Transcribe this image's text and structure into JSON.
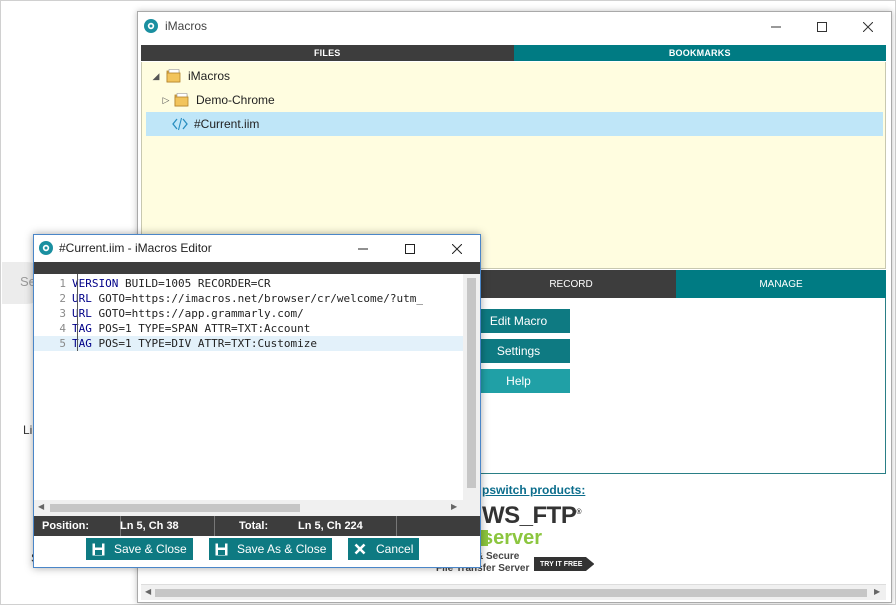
{
  "background": {
    "pill_text": "Se",
    "fragment_1": "Li",
    "fragment_2": "S"
  },
  "main_window": {
    "title": "iMacros",
    "tabs": {
      "files": "FILES",
      "bookmarks": "BOOKMARKS"
    },
    "tree": [
      {
        "label": "iMacros",
        "type": "folder",
        "expanded": true
      },
      {
        "label": "Demo-Chrome",
        "type": "folder",
        "expanded": false
      },
      {
        "label": "#Current.iim",
        "type": "macro",
        "selected": true
      }
    ],
    "sub_tabs": {
      "record": "RECORD",
      "manage": "MANAGE"
    },
    "buttons": {
      "edit_macro": "Edit Macro",
      "settings": "Settings",
      "help": "Help"
    },
    "ad": {
      "heading": "pswitch products:",
      "logo_main": "WS_FTP",
      "logo_reg": "®",
      "logo_sub": "server",
      "tagline_1": "& Secure",
      "tagline_2": "File Transfer Server",
      "try_free": "TRY IT FREE"
    }
  },
  "editor": {
    "title": "#Current.iim - iMacros Editor",
    "lines": [
      {
        "num": "1",
        "keyword": "VERSION",
        "rest": " BUILD=1005 RECORDER=CR"
      },
      {
        "num": "2",
        "keyword": "URL",
        "rest": " GOTO=https://imacros.net/browser/cr/welcome/?utm_"
      },
      {
        "num": "3",
        "keyword": "URL",
        "rest": " GOTO=https://app.grammarly.com/"
      },
      {
        "num": "4",
        "keyword": "TAG",
        "rest": " POS=1 TYPE=SPAN ATTR=TXT:Account"
      },
      {
        "num": "5",
        "keyword": "TAG",
        "rest": " POS=1 TYPE=DIV ATTR=TXT:Customize"
      }
    ],
    "status": {
      "position_label": "Position:",
      "position_value": "Ln 5, Ch 38",
      "total_label": "Total:",
      "total_value": "Ln 5, Ch 224"
    },
    "buttons": {
      "save_close": "Save & Close",
      "save_as_close": "Save As & Close",
      "cancel": "Cancel"
    }
  },
  "colors": {
    "teal": "#007b83",
    "dark": "#3d3d3d",
    "tree_bg": "#fffde0",
    "selection": "#bfe6f8"
  },
  "icons": [
    "imacros-icon",
    "minimize-icon",
    "maximize-icon",
    "close-icon",
    "folder-icon",
    "code-file-icon",
    "save-icon",
    "cancel-x-icon"
  ]
}
